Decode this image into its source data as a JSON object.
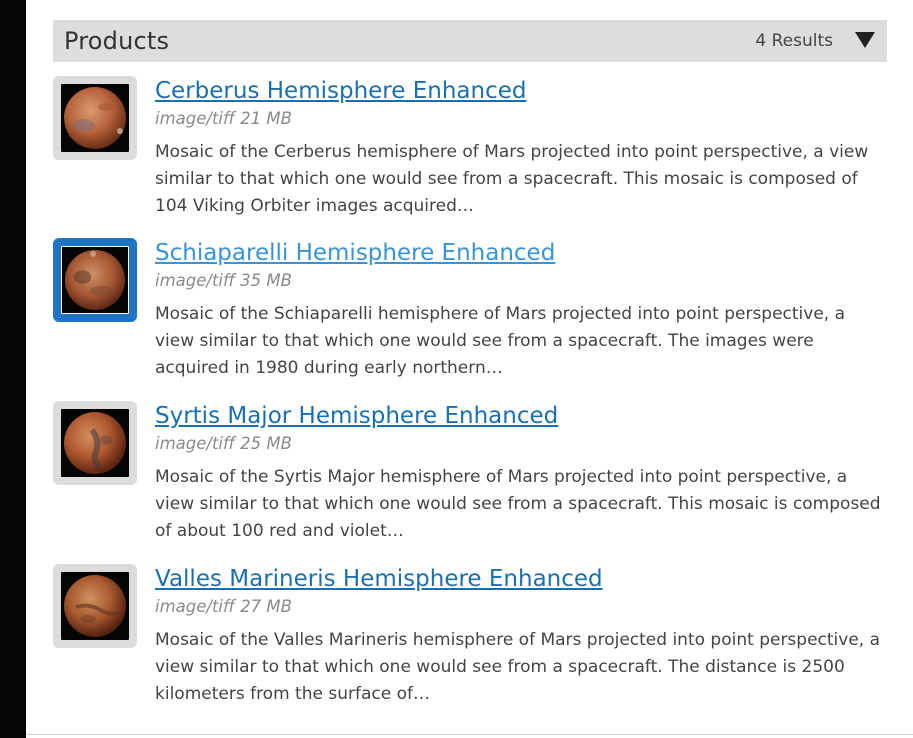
{
  "header": {
    "title": "Products",
    "count": "4 Results",
    "toggle_icon": "triangle-down-icon"
  },
  "colors": {
    "header_bg": "#dddddd",
    "link": "#1a6fb0",
    "link_hover": "#3a93d6",
    "selected_border": "#1f74c3"
  },
  "items": [
    {
      "title": "Cerberus Hemisphere Enhanced",
      "meta": "image/tiff 21 MB",
      "description": "Mosaic of the Cerberus hemisphere of Mars projected into point perspective, a view similar to that which one would see from a spacecraft. This mosaic is composed of 104 Viking Orbiter images acquired…",
      "selected": false
    },
    {
      "title": "Schiaparelli Hemisphere Enhanced",
      "meta": "image/tiff 35 MB",
      "description": "Mosaic of the Schiaparelli hemisphere of Mars projected into point perspective, a view similar to that which one would see from a spacecraft. The images were acquired in 1980 during early northern…",
      "selected": true
    },
    {
      "title": "Syrtis Major Hemisphere Enhanced",
      "meta": "image/tiff 25 MB",
      "description": "Mosaic of the Syrtis Major hemisphere of Mars projected into point perspective, a view similar to that which one would see from a spacecraft. This mosaic is composed of about 100 red and violet…",
      "selected": false
    },
    {
      "title": "Valles Marineris Hemisphere Enhanced",
      "meta": "image/tiff 27 MB",
      "description": "Mosaic of the Valles Marineris hemisphere of Mars projected into point perspective, a view similar to that which one would see from a spacecraft. The distance is 2500 kilometers from the surface of…",
      "selected": false
    }
  ]
}
